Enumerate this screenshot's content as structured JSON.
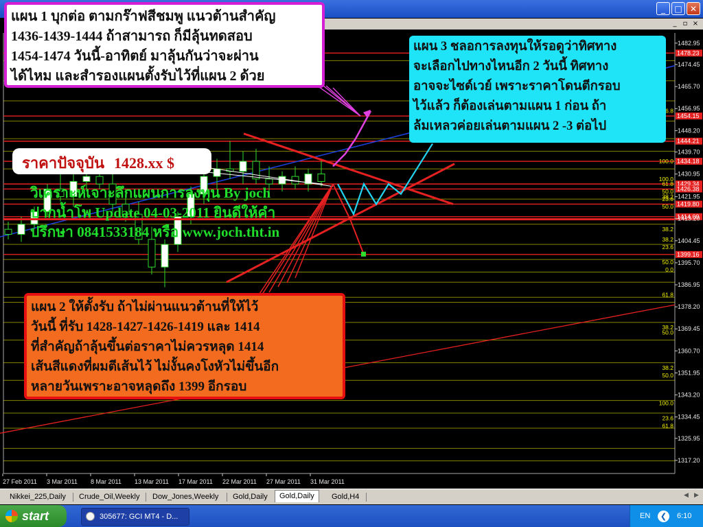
{
  "window": {
    "buttons": [
      "_",
      "□",
      "✕"
    ]
  },
  "mdi_buttons": [
    "_",
    "▫",
    "×"
  ],
  "notes": {
    "plan1": "แผน 1 บุกต่อ ตามกร๊าฟสีชมพู แนวต้านสำคัญ\n1436-1439-1444 ถ้าสามารถ ก็มีลุ้นทดสอบ\n1454-1474 วันนี้-อาทิตย์ มาลุ้นกันว่าจะผ่าน\nได้ไหม และสำรองแผนตั้งรับไว้ที่แผน 2 ด้วย",
    "plan3": "แผน 3 ชลอการลงทุนให้รอดูว่าทิศทาง\nจะเลือกไปทางไหนอีก 2 วันนี้ ทิศทาง\nอาจจะไซด์เวย์ เพราะราคาโดนตีกรอบ\nไว้แล้ว ก็ต้องเล่นตามแผน 1 ก่อน ถ้า\nล้มเหลวค่อยเล่นตามแผน 2 -3 ต่อไป",
    "plan2": "แผน 2 ให้ตั้งรับ ถ้าไม่ผ่านแนวต้านที่ให้ไว้\nวันนี้ ที่รับ 1428-1427-1426-1419 และ 1414\n ที่สำคัญถ้าลุ้นขึ้นต่อราคาไม่ควรหลุด 1414\nเส้นสีแดงที่ผมตีเส้นไว้ ไม่งั้นคงโงหัวไม่ขึ้นอีก\nหลายวันเพราะอาจหลุดถึง 1399 อีกรอบ"
  },
  "price_box": {
    "label": "ราคาปัจจุบัน",
    "value": "1428.xx $"
  },
  "green_text": {
    "line1": "วิเคราะห์เจาะลึกแผนการลงทุน By joch",
    "line2": "ปากน้ำโพ Update 04-03-2011 ยินดีให้คำ",
    "line3": "ปรึกษา 0841533184 หรือ www.joch.tht.in"
  },
  "tabs": [
    "Nikkei_225,Daily",
    "Crude_Oil,Weekly",
    "Dow_Jones,Weekly",
    "Gold,Daily",
    "Gold,Daily",
    "Gold,H4"
  ],
  "active_tab": 4,
  "taskbar": {
    "start": "start",
    "task": "305677: GCI MT4 - D...",
    "lang": "EN",
    "clock": "6:10"
  },
  "chart_data": {
    "type": "candlestick",
    "instrument": "Gold",
    "timeframe": "Daily",
    "price_axis": {
      "ticks": [
        "1482.95",
        "1474.45",
        "1465.70",
        "1456.95",
        "1448.20",
        "1439.70",
        "1430.95",
        "1421.95",
        "1413.20",
        "1404.45",
        "1395.70",
        "1386.95",
        "1378.20",
        "1369.45",
        "1360.70",
        "1351.95",
        "1343.20",
        "1334.45",
        "1325.95",
        "1317.20"
      ],
      "range": [
        1312,
        1487
      ]
    },
    "date_axis": {
      "labels": [
        "27 Feb 2011",
        "3 Mar 2011",
        "8 Mar 2011",
        "13 Mar 2011",
        "17 Mar 2011",
        "22 Mar 2011",
        "27 Mar 2011",
        "31 Mar 2011"
      ]
    },
    "marked_levels": [
      {
        "price": 1479,
        "label": "1478.23",
        "color": "#e52020"
      },
      {
        "price": 1454,
        "label": "1454.15",
        "color": "#e52020"
      },
      {
        "price": 1444,
        "label": "1444.21",
        "color": "#e52020"
      },
      {
        "price": 1436,
        "label": "1434.18",
        "color": "#e52020"
      },
      {
        "price": 1427,
        "label": "1429.34",
        "color": "#e52020"
      },
      {
        "price": 1425,
        "label": "1426.38",
        "color": "#e52020"
      },
      {
        "price": 1419,
        "label": "1419.80",
        "color": "#e52020"
      },
      {
        "price": 1414,
        "label": "1414.09",
        "color": "#e52020"
      },
      {
        "price": 1399,
        "label": "1399.16",
        "color": "#e52020"
      }
    ],
    "fib_labels": [
      {
        "price": 1456,
        "text": "6.8"
      },
      {
        "price": 1436,
        "text": "100.0"
      },
      {
        "price": 1429,
        "text": "100.0"
      },
      {
        "price": 1427,
        "text": "61.8"
      },
      {
        "price": 1424,
        "text": "50.0"
      },
      {
        "price": 1422,
        "text": "38.2"
      },
      {
        "price": 1421,
        "text": "23.6"
      },
      {
        "price": 1418,
        "text": "50.0"
      },
      {
        "price": 1409,
        "text": "38.2"
      },
      {
        "price": 1405,
        "text": "38.2"
      },
      {
        "price": 1402,
        "text": "23.6"
      },
      {
        "price": 1396,
        "text": "50.0"
      },
      {
        "price": 1393,
        "text": "0.0"
      },
      {
        "price": 1383,
        "text": "61.8"
      },
      {
        "price": 1370,
        "text": "38.2"
      },
      {
        "price": 1368,
        "text": "50.0"
      },
      {
        "price": 1354,
        "text": "38.2"
      },
      {
        "price": 1351,
        "text": "50.0"
      },
      {
        "price": 1340,
        "text": "100.0"
      },
      {
        "price": 1334,
        "text": "23.6"
      },
      {
        "price": 1331,
        "text": "61.8"
      }
    ],
    "candles": [
      {
        "o": 1409,
        "h": 1412,
        "l": 1405,
        "c": 1407
      },
      {
        "o": 1407,
        "h": 1414,
        "l": 1404,
        "c": 1411
      },
      {
        "o": 1411,
        "h": 1418,
        "l": 1409,
        "c": 1416
      },
      {
        "o": 1416,
        "h": 1427,
        "l": 1414,
        "c": 1425
      },
      {
        "o": 1425,
        "h": 1433,
        "l": 1420,
        "c": 1422
      },
      {
        "o": 1422,
        "h": 1431,
        "l": 1418,
        "c": 1428
      },
      {
        "o": 1428,
        "h": 1434,
        "l": 1424,
        "c": 1430
      },
      {
        "o": 1430,
        "h": 1436,
        "l": 1425,
        "c": 1427
      },
      {
        "o": 1427,
        "h": 1432,
        "l": 1416,
        "c": 1419
      },
      {
        "o": 1419,
        "h": 1425,
        "l": 1412,
        "c": 1415
      },
      {
        "o": 1415,
        "h": 1420,
        "l": 1403,
        "c": 1405
      },
      {
        "o": 1405,
        "h": 1410,
        "l": 1391,
        "c": 1394
      },
      {
        "o": 1394,
        "h": 1405,
        "l": 1386,
        "c": 1403
      },
      {
        "o": 1403,
        "h": 1416,
        "l": 1400,
        "c": 1414
      },
      {
        "o": 1414,
        "h": 1426,
        "l": 1411,
        "c": 1423
      },
      {
        "o": 1423,
        "h": 1433,
        "l": 1419,
        "c": 1430
      },
      {
        "o": 1430,
        "h": 1437,
        "l": 1425,
        "c": 1433
      },
      {
        "o": 1433,
        "h": 1444,
        "l": 1429,
        "c": 1432
      },
      {
        "o": 1432,
        "h": 1440,
        "l": 1427,
        "c": 1436
      },
      {
        "o": 1436,
        "h": 1441,
        "l": 1427,
        "c": 1429
      },
      {
        "o": 1429,
        "h": 1434,
        "l": 1424,
        "c": 1427
      },
      {
        "o": 1427,
        "h": 1432,
        "l": 1424,
        "c": 1430
      },
      {
        "o": 1430,
        "h": 1434,
        "l": 1425,
        "c": 1427
      },
      {
        "o": 1427,
        "h": 1433,
        "l": 1424,
        "c": 1431
      },
      {
        "o": 1431,
        "h": 1437,
        "l": 1426,
        "c": 1428
      }
    ],
    "colors": {
      "background": "#000000",
      "up": "#ffffff",
      "down": "#000000",
      "wick": "#2edd2e",
      "trend": "#1a3fd8",
      "level": "#f0f000",
      "marked": "#e52020",
      "plan1": "#e040e0",
      "plan2": "#e52020",
      "plan3": "#22d4f2"
    }
  }
}
